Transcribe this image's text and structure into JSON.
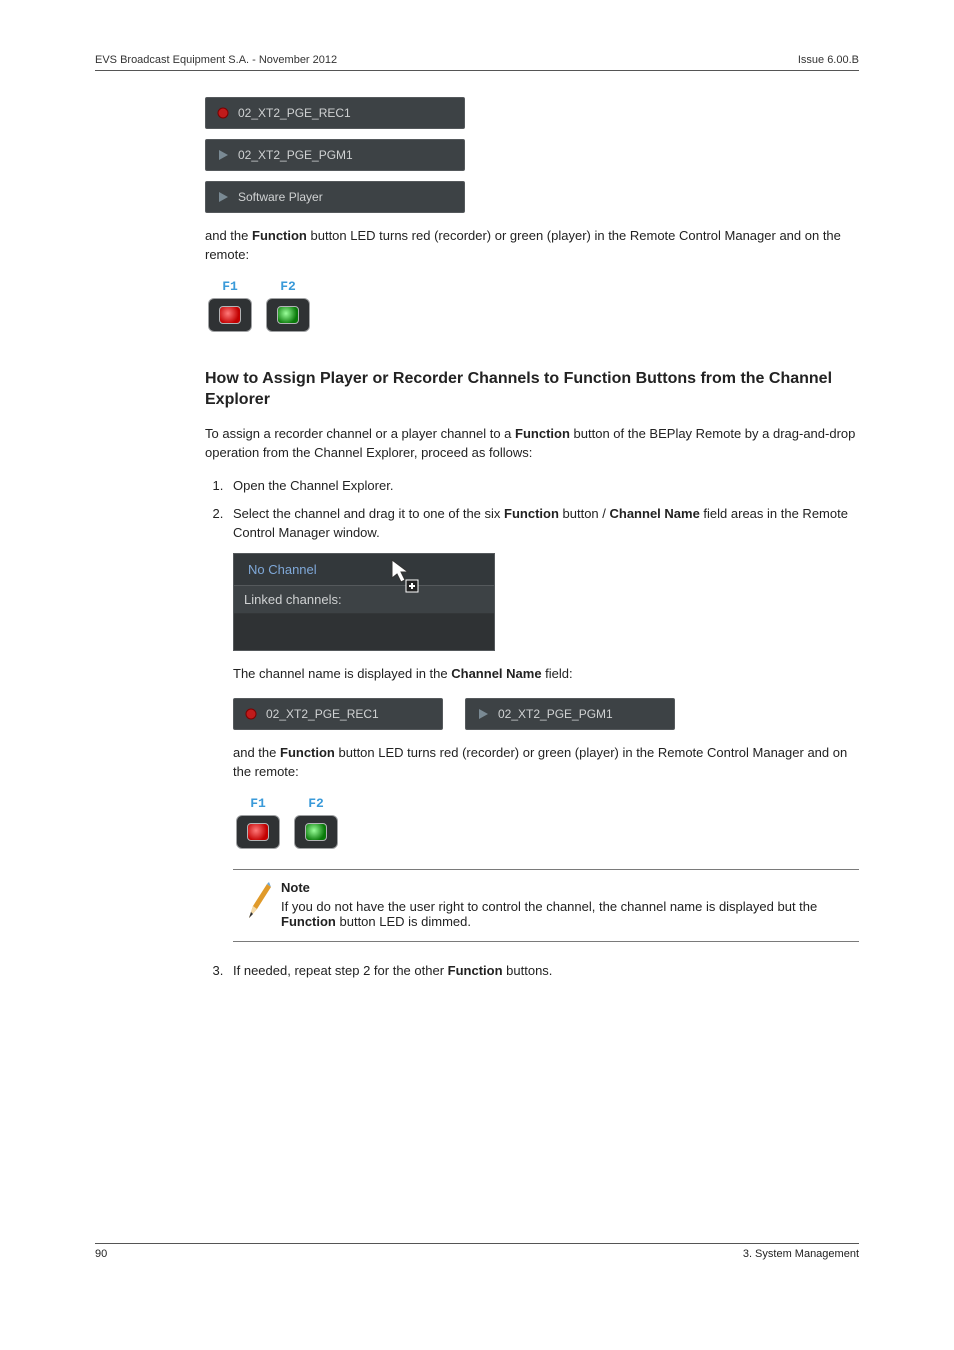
{
  "header": {
    "left": "EVS Broadcast Equipment S.A. - November 2012",
    "right": "Issue 6.00.B"
  },
  "chips": {
    "rec1": "02_XT2_PGE_REC1",
    "pgm1": "02_XT2_PGE_PGM1",
    "swplayer": "Software Player"
  },
  "para1_a": "and the ",
  "para1_b": "Function",
  "para1_c": " button LED turns red (recorder) or green (player) in the Remote Control Manager and on the remote:",
  "fbtn": {
    "f1": "F1",
    "f2": "F2"
  },
  "subhead": "How to Assign Player or Recorder Channels to Function Buttons from the Channel Explorer",
  "intro_a": "To assign a recorder channel or a player channel to a ",
  "intro_b": "Function",
  "intro_c": " button of the BEPlay Remote by a drag-and-drop operation from the Channel Explorer, proceed as follows:",
  "step1": "Open the Channel Explorer.",
  "step2_a": "Select the channel and drag it to one of the six ",
  "step2_b": "Function",
  "step2_c": " button / ",
  "step2_d": "Channel Name",
  "step2_e": " field areas in the Remote Control Manager window.",
  "nochannel": "No Channel",
  "linked": "Linked channels:",
  "chname_a": "The channel name is displayed in the ",
  "chname_b": "Channel Name",
  "chname_c": " field:",
  "para2_a": "and the ",
  "para2_b": "Function",
  "para2_c": " button LED turns red (recorder) or green (player) in the Remote Control Manager and on the remote:",
  "note_title": "Note",
  "note_a": "If you do not have the user right to control the channel, the channel name is displayed but the ",
  "note_b": "Function",
  "note_c": " button LED is dimmed.",
  "step3_a": "If needed, repeat step 2 for the other ",
  "step3_b": "Function",
  "step3_c": " buttons.",
  "footer": {
    "left": "90",
    "right": "3. System Management"
  }
}
